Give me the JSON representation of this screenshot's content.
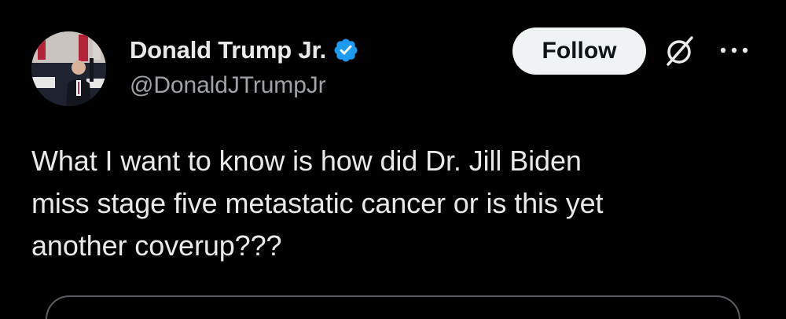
{
  "author": {
    "display_name": "Donald Trump Jr.",
    "handle": "@DonaldJTrumpJr",
    "verified": true,
    "verified_color": "#1d9bf0",
    "avatar_icon": "profile-photo"
  },
  "actions": {
    "follow_label": "Follow",
    "grok_icon": "slashed-circle-icon",
    "more_icon": "ellipsis-icon"
  },
  "tweet": {
    "text_lines": [
      "What I want to know is how did Dr. Jill Biden",
      "miss stage five metastatic cancer or is this yet",
      "another coverup???"
    ]
  },
  "colors": {
    "background": "#000000",
    "primary_text": "#e7e9ea",
    "secondary_text": "#9fa3a8",
    "follow_bg": "#eff3f4",
    "follow_text": "#0f1419"
  }
}
